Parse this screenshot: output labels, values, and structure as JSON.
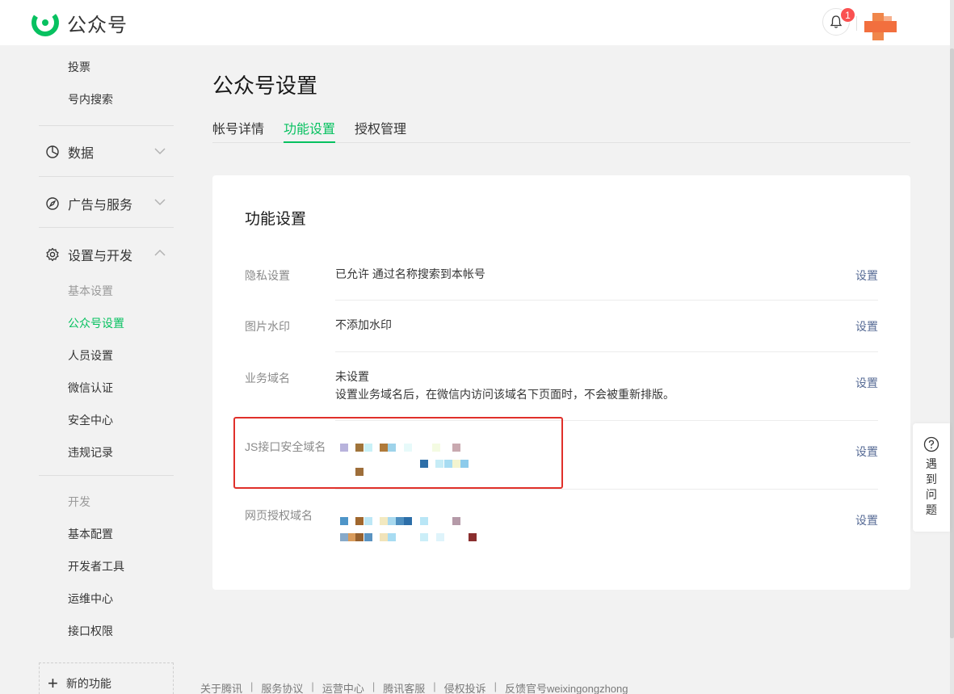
{
  "app": {
    "name": "公众号"
  },
  "header": {
    "notification_count": "1"
  },
  "sidebar": {
    "top_items": [
      "投票",
      "号内搜索"
    ],
    "groups": [
      {
        "label": "数据",
        "icon": "pie-chart-icon",
        "expanded": false
      },
      {
        "label": "广告与服务",
        "icon": "compass-icon",
        "expanded": false
      },
      {
        "label": "设置与开发",
        "icon": "gear-icon",
        "expanded": true
      }
    ],
    "settings_items": [
      "基本设置",
      "公众号设置",
      "人员设置",
      "微信认证",
      "安全中心",
      "违规记录"
    ],
    "active_item": "公众号设置",
    "dev_section_label": "开发",
    "dev_items": [
      "基本配置",
      "开发者工具",
      "运维中心",
      "接口权限"
    ],
    "new_function": "新的功能"
  },
  "main": {
    "page_title": "公众号设置",
    "tabs": [
      {
        "label": "帐号详情",
        "active": false
      },
      {
        "label": "功能设置",
        "active": true
      },
      {
        "label": "授权管理",
        "active": false
      }
    ],
    "card_title": "功能设置",
    "rows": [
      {
        "label": "隐私设置",
        "value": "已允许 通过名称搜索到本帐号",
        "value2": "",
        "action": "设置"
      },
      {
        "label": "图片水印",
        "value": "不添加水印",
        "value2": "",
        "action": "设置"
      },
      {
        "label": "业务域名",
        "value": "未设置",
        "value2": "设置业务域名后，在微信内访问该域名下页面时，不会被重新排版。",
        "action": "设置"
      },
      {
        "label": "JS接口安全域名",
        "value": "",
        "value2": "",
        "action": "设置"
      },
      {
        "label": "网页授权域名",
        "value": "",
        "value2": "",
        "action": "设置"
      }
    ]
  },
  "help": {
    "label": "遇到问题"
  },
  "footer": {
    "links": [
      "关于腾讯",
      "服务协议",
      "运营中心",
      "腾讯客服",
      "侵权投诉",
      "反馈官号weixingongzhong"
    ]
  },
  "colors": {
    "accent": "#07c160",
    "link": "#576b95",
    "highlight_box": "#e0302a",
    "badge": "#fa5151"
  }
}
